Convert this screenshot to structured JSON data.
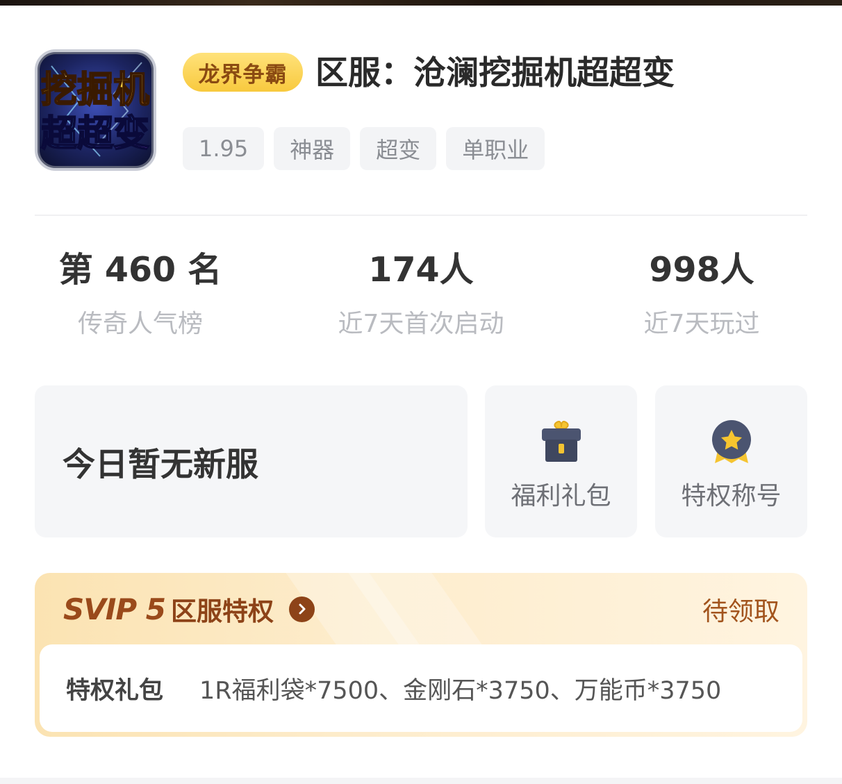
{
  "header": {
    "guild_badge": "龙界争霸",
    "server_title": "区服：沧澜挖掘机超超变",
    "icon_text_line1": "挖掘机",
    "icon_text_line2": "超超变",
    "tags": [
      "1.95",
      "神器",
      "超变",
      "单职业"
    ]
  },
  "stats": [
    {
      "value": "第 460 名",
      "label": "传奇人气榜"
    },
    {
      "value": "174人",
      "label": "近7天首次启动"
    },
    {
      "value": "998人",
      "label": "近7天玩过"
    }
  ],
  "cards": {
    "new_server": "今日暂无新服",
    "gift": {
      "label": "福利礼包",
      "icon": "gift-box-icon"
    },
    "title": {
      "label": "特权称号",
      "icon": "medal-star-icon"
    }
  },
  "svip": {
    "logo_text": "SVIP 5",
    "title": "区服特权",
    "status": "待领取",
    "perk_label": "特权礼包",
    "perk_value": "1R福利袋*7500、金刚石*3750、万能币*3750"
  },
  "colors": {
    "badge_gold": "#f8c93e",
    "svip_brown": "#8d4318",
    "tag_bg": "#f3f4f6",
    "card_bg": "#f5f6f8"
  }
}
